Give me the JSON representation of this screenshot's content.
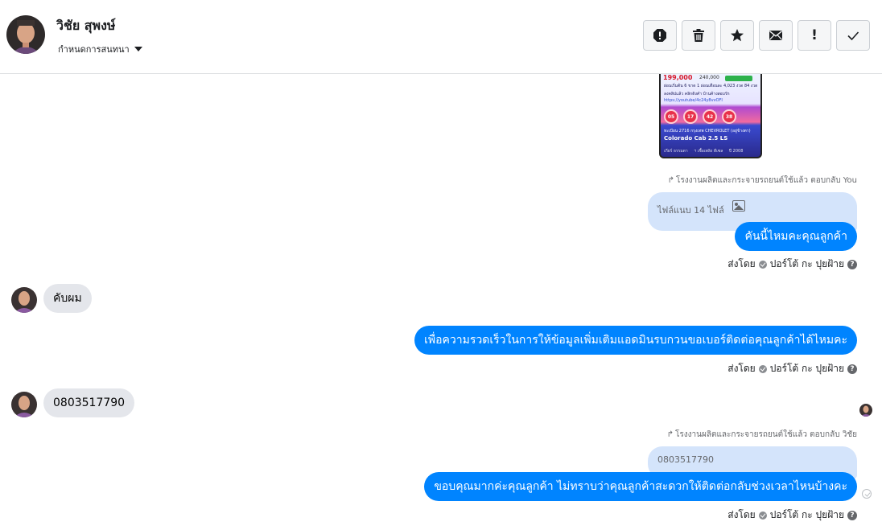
{
  "header": {
    "name": "วิชัย สุพงษ์",
    "assign_label": "กำหนดการสนทนา",
    "toolbar": [
      "spam-alert-icon",
      "trash-icon",
      "star-icon",
      "envelope-icon",
      "exclamation-icon",
      "check-icon"
    ],
    "toolbar_glyph_exclaim": "!"
  },
  "product_card": {
    "price": "199,000",
    "old_price": "240,000",
    "line1": "ผ่อนเริ่มต้น 6 ขาด 1 ผ่อนเดือนละ 4,023 งวด 84 งวด",
    "line2": "ลงคลิปแล้ว คลิกดิงคำ บ้านค้างสอบรัก",
    "line3": "https://youtube/4c24y8vvOFI",
    "balls": [
      "05",
      "17",
      "42",
      "38"
    ],
    "line4": "ทะเบียน 2716 กรุงเทพ CHEVROLET (อยู่ข้างตา)",
    "model": "Colorado Cab 2.5 LS",
    "footer_left": "เกียร์ ธรรมดา",
    "footer_mid": "ฯ เชื้อเพลิง ดีเซล",
    "footer_right": "ปี 2008"
  },
  "messages": {
    "reply_note_1": "โรงงานผลิตและกระจายรถยนต์ใช้แล้ว ตอบกลับ You",
    "quote_1": "ไฟล์แนบ 14 ไฟล์",
    "out_1": "คันนี้ไหมคะคุณลูกค้า",
    "sent_by_label": "ส่งโดย",
    "sent_by_name": "ปอร์โต้ กะ ปุยฝ้าย",
    "help_glyph": "?",
    "in_1": "คับผม",
    "out_2": "เพื่อความรวดเร็วในการให้ข้อมูลเพิ่มเติมแอดมินรบกวนขอเบอร์ติดต่อคุณลูกค้าได้ไหมคะ",
    "in_2": "0803517790",
    "reply_note_2": "โรงงานผลิตและกระจายรถยนต์ใช้แล้ว ตอบกลับ วิชัย",
    "quote_2": "0803517790",
    "out_3": "ขอบคุณมากค่ะคุณลูกค้า ไม่ทราบว่าคุณลูกค้าสะดวกให้ติดต่อกลับช่วงเวลาไหนบ้างคะ",
    "reply_arrow": "↱"
  },
  "colors": {
    "outgoing_bubble": "#0084ff",
    "incoming_bubble": "#e4e6eb",
    "quoted_bubble": "#d4e4fb"
  }
}
